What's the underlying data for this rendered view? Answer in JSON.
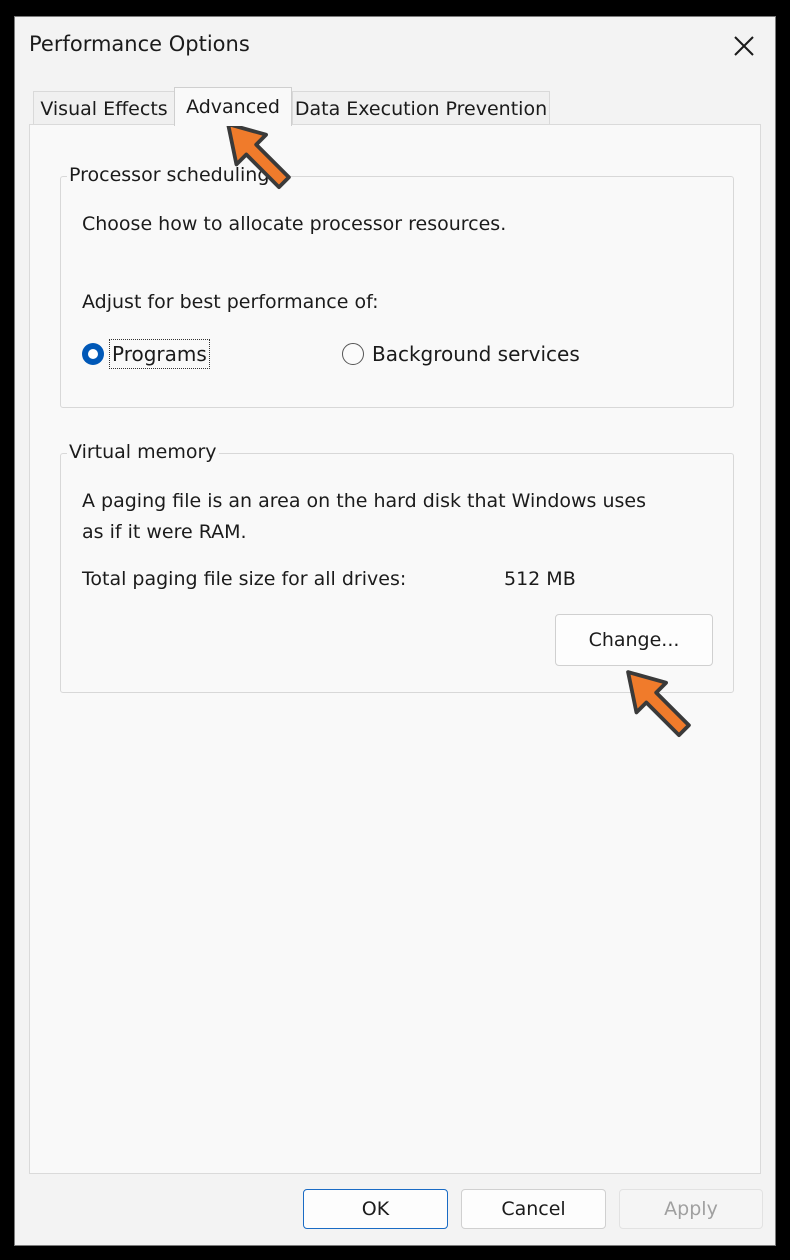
{
  "window": {
    "title": "Performance Options"
  },
  "tabs": [
    {
      "label": "Visual Effects"
    },
    {
      "label": "Advanced"
    },
    {
      "label": "Data Execution Prevention"
    }
  ],
  "processor": {
    "legend": "Processor scheduling",
    "description": "Choose how to allocate processor resources.",
    "adjust_label": "Adjust for best performance of:",
    "options": [
      {
        "label": "Programs",
        "selected": true
      },
      {
        "label": "Background services",
        "selected": false
      }
    ]
  },
  "memory": {
    "legend": "Virtual memory",
    "description_line1": "A paging file is an area on the hard disk that Windows uses",
    "description_line2": "as if it were RAM.",
    "total_label": "Total paging file size for all drives:",
    "total_value": "512 MB",
    "change_label": "Change..."
  },
  "footer": {
    "ok": "OK",
    "cancel": "Cancel",
    "apply": "Apply"
  },
  "colors": {
    "accent": "#0058b7",
    "annotation_arrow": "#f07b2b"
  },
  "icons": {
    "close": "close-icon",
    "arrow": "arrow-annotation-icon"
  }
}
